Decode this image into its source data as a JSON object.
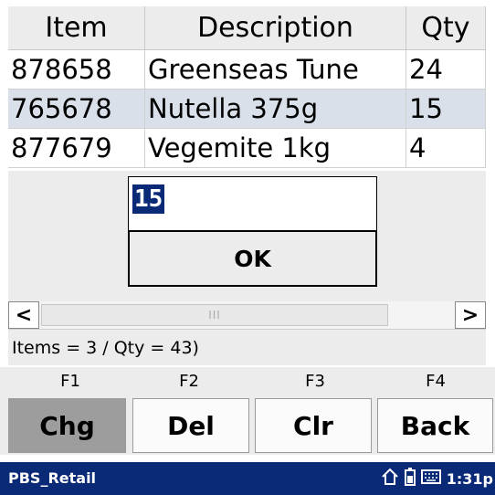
{
  "grid": {
    "headers": [
      "Item",
      "Description",
      "Qty"
    ],
    "rows": [
      {
        "item": "878658",
        "description": "Greenseas Tune",
        "qty": "24"
      },
      {
        "item": "765678",
        "description": "Nutella 375g",
        "qty": "15"
      },
      {
        "item": "877679",
        "description": "Vegemite 1kg",
        "qty": "4"
      }
    ]
  },
  "dialog": {
    "qty_value": "15",
    "ok_label": "OK"
  },
  "scrollbar": {
    "thumb_grip": "III"
  },
  "status": "Items = 3 / Qty = 43)",
  "fkeys": [
    "F1",
    "F2",
    "F3",
    "F4"
  ],
  "buttons": [
    "Chg",
    "Del",
    "Clr",
    "Back"
  ],
  "taskbar": {
    "app_name": "PBS_Retail",
    "time": "1:31p"
  }
}
